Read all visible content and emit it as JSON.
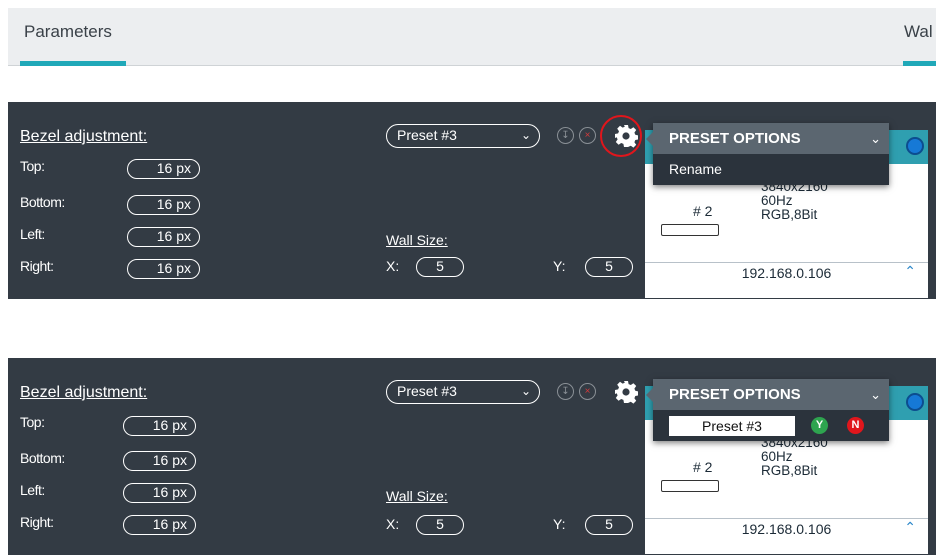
{
  "header": {
    "tabs": [
      {
        "label": "Parameters",
        "active": true
      },
      {
        "label": "Wal",
        "active": true
      }
    ]
  },
  "panels": [
    {
      "bezel": {
        "title": "Bezel adjustment:",
        "rows": [
          {
            "label": "Top:",
            "value": "16 px"
          },
          {
            "label": "Bottom:",
            "value": "16 px"
          },
          {
            "label": "Left:",
            "value": "16 px"
          },
          {
            "label": "Right:",
            "value": "16 px"
          }
        ]
      },
      "preset": {
        "selected": "Preset #3"
      },
      "icons": {
        "download": "download-icon",
        "delete": "close-icon",
        "gear": "gear-icon"
      },
      "wall": {
        "label": "Wall Size:",
        "x_label": "X:",
        "x_value": "5",
        "y_label": "Y:",
        "y_value": "5"
      },
      "menu": {
        "title": "PRESET OPTIONS",
        "item": "Rename"
      },
      "card": {
        "id": "# 2",
        "specs": [
          "3840x2160",
          "60Hz",
          "RGB,8Bit"
        ],
        "ip": "192.168.0.106"
      }
    },
    {
      "bezel": {
        "title": "Bezel adjustment:",
        "rows": [
          {
            "label": "Top:",
            "value": "16 px"
          },
          {
            "label": "Bottom:",
            "value": "16 px"
          },
          {
            "label": "Left:",
            "value": "16 px"
          },
          {
            "label": "Right:",
            "value": "16 px"
          }
        ]
      },
      "preset": {
        "selected": "Preset #3"
      },
      "icons": {
        "download": "download-icon",
        "delete": "close-icon",
        "gear": "gear-icon"
      },
      "wall": {
        "label": "Wall Size:",
        "x_label": "X:",
        "x_value": "5",
        "y_label": "Y:",
        "y_value": "5"
      },
      "menu": {
        "title": "PRESET OPTIONS",
        "rename_value": "Preset #3",
        "confirm": "Y",
        "cancel": "N"
      },
      "card": {
        "id": "# 2",
        "specs": [
          "3840x2160",
          "60Hz",
          "RGB,8Bit"
        ],
        "ip": "192.168.0.106"
      }
    }
  ],
  "colors": {
    "panel_bg": "#333b44",
    "accent": "#20a8b8",
    "menu_head": "#5b6670",
    "confirm_green": "#2ea44f",
    "cancel_red": "#e0161c",
    "highlight_ring": "#e0161c"
  }
}
